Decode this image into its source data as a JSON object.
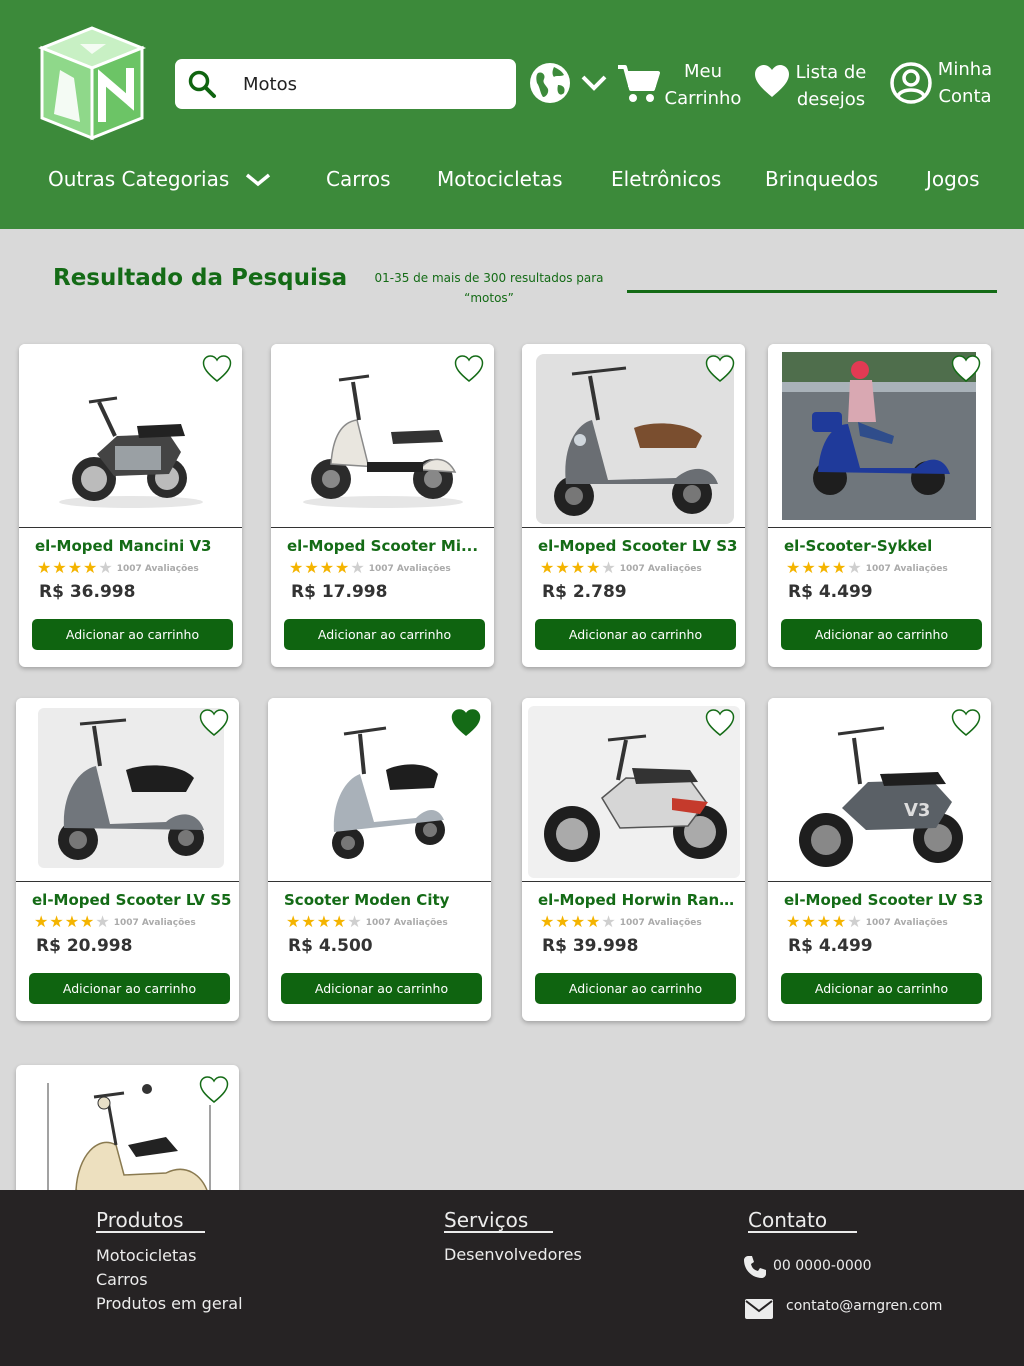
{
  "colors": {
    "header_green": "#3c8a3a",
    "dark_green": "#146b16",
    "button_green": "#0f6410",
    "star": "#f4b400",
    "footer": "#262324"
  },
  "search": {
    "value": "Motos",
    "icon": "search-icon"
  },
  "header": {
    "globe_icon": "globe-icon",
    "cart_label_1": "Meu",
    "cart_label_2": "Carrinho",
    "wishlist_label_1": "Lista de",
    "wishlist_label_2": "desejos",
    "account_label_1": "Minha",
    "account_label_2": "Conta"
  },
  "nav": {
    "other": "Outras Categorias",
    "items": [
      "Carros",
      "Motocicletas",
      "Eletrônicos",
      "Brinquedos",
      "Jogos"
    ]
  },
  "results": {
    "title": "Resultado da Pesquisa",
    "summary_1": "01-35 de mais de 300 resultados para",
    "summary_2": "“motos”"
  },
  "products": [
    {
      "name": "el-Moped Mancini V3",
      "reviews": "1007 Avaliações",
      "price": "R$ 36.998",
      "rating": 4,
      "favorite": false,
      "button": "Adicionar ao carrinho"
    },
    {
      "name": "el-Moped Scooter Mi...",
      "reviews": "1007 Avaliações",
      "price": "R$ 17.998",
      "rating": 4,
      "favorite": false,
      "button": "Adicionar ao carrinho"
    },
    {
      "name": "el-Moped Scooter LV S3",
      "reviews": "1007 Avaliações",
      "price": "R$ 2.789",
      "rating": 4,
      "favorite": false,
      "button": "Adicionar ao carrinho"
    },
    {
      "name": "el-Scooter-Sykkel",
      "reviews": "1007 Avaliações",
      "price": "R$ 4.499",
      "rating": 4,
      "favorite": false,
      "button": "Adicionar ao carrinho"
    },
    {
      "name": "el-Moped Scooter LV S5",
      "reviews": "1007 Avaliações",
      "price": "R$ 20.998",
      "rating": 4,
      "favorite": false,
      "button": "Adicionar ao carrinho"
    },
    {
      "name": "Scooter Moden City",
      "reviews": "1007 Avaliações",
      "price": "R$ 4.500",
      "rating": 4,
      "favorite": true,
      "button": "Adicionar ao carrinho"
    },
    {
      "name": "el-Moped Horwin Ranger",
      "reviews": "1007 Avaliações",
      "price": "R$ 39.998",
      "rating": 4,
      "favorite": false,
      "button": "Adicionar ao carrinho"
    },
    {
      "name": "el-Moped Scooter LV S3",
      "reviews": "1007 Avaliações",
      "price": "R$ 4.499",
      "rating": 4,
      "favorite": false,
      "button": "Adicionar ao carrinho"
    }
  ],
  "footer": {
    "products_title": "Produtos",
    "products_links": [
      "Motocicletas",
      "Carros",
      "Produtos em geral"
    ],
    "services_title": "Serviços",
    "services_links": [
      "Desenvolvedores"
    ],
    "contact_title": "Contato",
    "phone": "00 0000-0000",
    "email": "contato@arngren.com"
  }
}
